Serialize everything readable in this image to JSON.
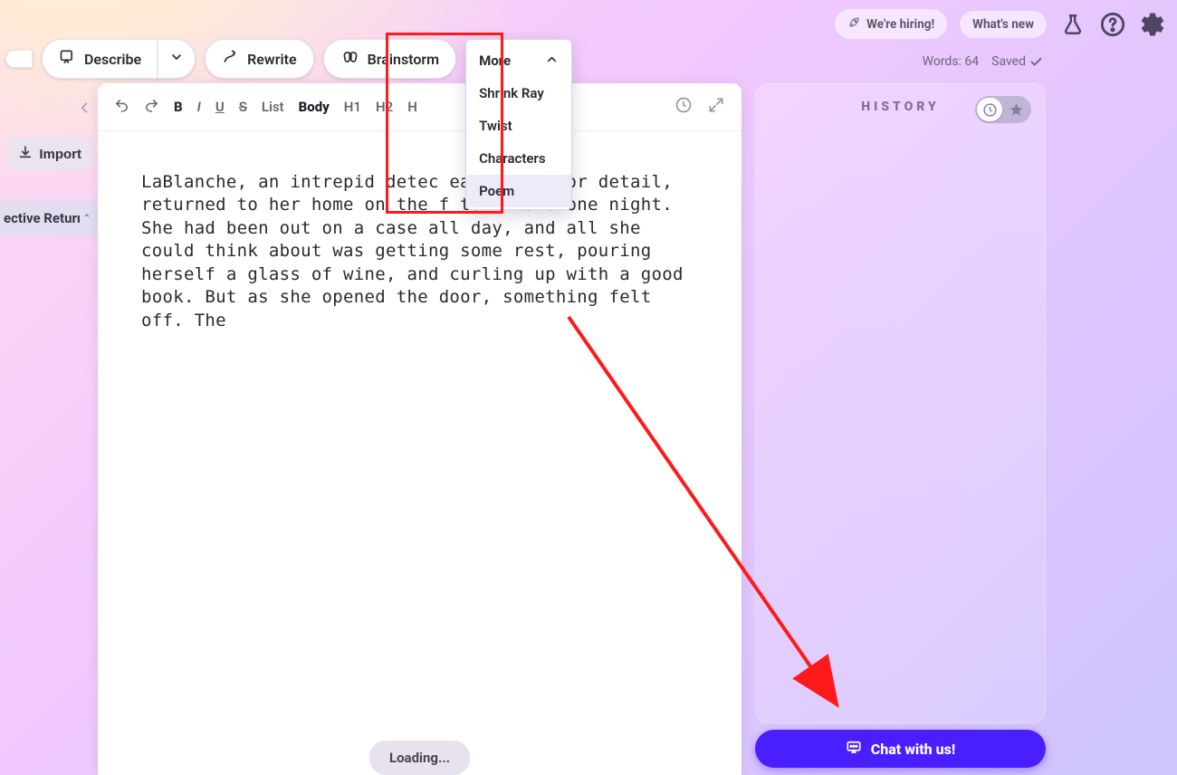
{
  "header": {
    "hiring_label": "We're hiring!",
    "whats_new_label": "What's new"
  },
  "status": {
    "words_label": "Words: 64",
    "saved_label": "Saved"
  },
  "toolbar": {
    "describe_label": "Describe",
    "rewrite_label": "Rewrite",
    "brainstorm_label": "Brainstorm",
    "more_label": "More",
    "more_items": {
      "shrink_ray": "Shrink Ray",
      "twist": "Twist",
      "characters": "Characters",
      "poem": "Poem"
    }
  },
  "left": {
    "import_label": "Import",
    "file_title": "ective Return"
  },
  "editor": {
    "fmt": {
      "list": "List",
      "body": "Body",
      "h1": "H1",
      "h2": "H2",
      "h3": "H"
    },
    "content": "LaBlanche, an intrepid detec            eagle eye for detail, returned to her home on the            f town late one night. She had been out on a case all day, and all she could think about was getting some rest, pouring herself a glass of wine, and curling up with a good book. But as she opened the door, something felt off. The",
    "loading_label": "Loading..."
  },
  "history": {
    "title": "HISTORY"
  },
  "chat": {
    "label": "Chat with us!"
  }
}
